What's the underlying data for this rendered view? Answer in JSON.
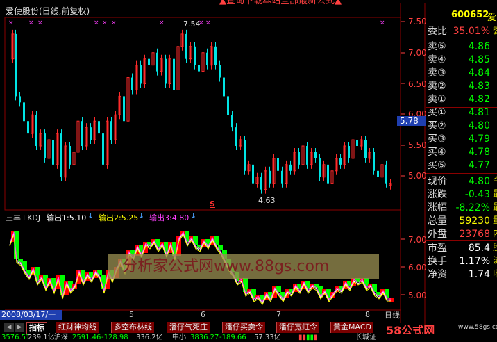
{
  "header": {
    "stock_title": "爱使股份(日线,前复权)",
    "news_ticker": "▲查询下载本站全部最新公式▲"
  },
  "price_axis": {
    "ticks": [
      "7.50",
      "7.00",
      "6.50",
      "6.00",
      "5.50",
      "5.00"
    ],
    "current_price_tag": "5.78",
    "high_marker": "7.54",
    "low_marker": "4.63",
    "s_marker": "S"
  },
  "indicator": {
    "name": "三丰+KDJ",
    "out1": "输出1:5.10",
    "out2": "输出2:5.25",
    "out3": "输出3:4.80",
    "ticks": [
      "7.00",
      "6.00",
      "5.00"
    ],
    "watermark": "分析家公式网www.88gs.com"
  },
  "date_axis": {
    "cursor_date": "2008/03/17/一",
    "months": [
      "5",
      "6",
      "7",
      "8"
    ],
    "period_label": "日线"
  },
  "quote_panel": {
    "code": "600652",
    "name": "爱",
    "webi": {
      "label": "委比",
      "value": "35.01%",
      "ext": "委"
    },
    "asks": [
      {
        "label": "卖⑤",
        "value": "4.86"
      },
      {
        "label": "卖④",
        "value": "4.85"
      },
      {
        "label": "卖③",
        "value": "4.84"
      },
      {
        "label": "卖②",
        "value": "4.83"
      },
      {
        "label": "卖①",
        "value": "4.82"
      }
    ],
    "bids": [
      {
        "label": "买①",
        "value": "4.81"
      },
      {
        "label": "买②",
        "value": "4.80"
      },
      {
        "label": "买③",
        "value": "4.79"
      },
      {
        "label": "买④",
        "value": "4.78"
      },
      {
        "label": "买⑤",
        "value": "4.77"
      }
    ],
    "stats": [
      {
        "label": "现价",
        "value": "4.80",
        "ext": "今",
        "color": "#00ff00"
      },
      {
        "label": "涨跌",
        "value": "-0.43",
        "ext": "最",
        "color": "#00ff00"
      },
      {
        "label": "涨幅",
        "value": "-8.22%",
        "ext": "最",
        "color": "#00ff00"
      },
      {
        "label": "总量",
        "value": "59230",
        "ext": "量",
        "color": "#ffff00"
      },
      {
        "label": "外盘",
        "value": "23768",
        "ext": "内",
        "color": "#ff4040"
      }
    ],
    "stats2": [
      {
        "label": "市盈",
        "value": "85.4",
        "ext": "股"
      },
      {
        "label": "换手",
        "value": "1.17%",
        "ext": "流"
      },
      {
        "label": "净资",
        "value": "1.74",
        "ext": "收"
      }
    ]
  },
  "tabs": [
    "指标",
    "红财神均线",
    "多空布林线",
    "潘仔气死庄",
    "潘仔买卖令",
    "潘仔宽虹令",
    "黄金MACD"
  ],
  "branding": {
    "logo": "58公式网",
    "url": "www.58gs.com"
  },
  "status_bar": {
    "item1": "3576.51",
    "item1_amt": "239.1亿",
    "item2_label": "沪深",
    "item2": "2591.46",
    "item2_chg": "-128.98",
    "item2_amt": "336.2亿",
    "item3_label": "中小",
    "item3": "3836.27",
    "item3_chg": "-189.66",
    "item3_amt": "57.33亿",
    "right_label": "长城证"
  },
  "colors": {
    "up": "#ff2a2a",
    "down": "#00e5e5",
    "ind_up": "#ff0000",
    "ind_down": "#00ff00",
    "grid": "#8b0000"
  }
}
